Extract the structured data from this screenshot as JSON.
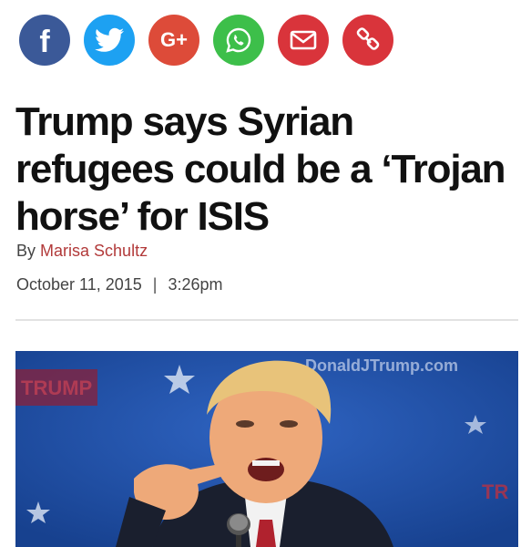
{
  "share": [
    {
      "name": "facebook",
      "icon": "facebook-icon",
      "color": "#3b5998"
    },
    {
      "name": "twitter",
      "icon": "twitter-icon",
      "color": "#1da1f2"
    },
    {
      "name": "google-plus",
      "icon": "google-plus-icon",
      "color": "#dd4b39",
      "label": "G+"
    },
    {
      "name": "whatsapp",
      "icon": "whatsapp-icon",
      "color": "#3dbf4a"
    },
    {
      "name": "email",
      "icon": "email-icon",
      "color": "#d9343b"
    },
    {
      "name": "link",
      "icon": "link-icon",
      "color": "#d9343b"
    }
  ],
  "article": {
    "headline": "Trump says Syrian refugees could be a ‘Trojan horse’ for ISIS",
    "byline_prefix": "By",
    "author": "Marisa Schultz",
    "date": "October 11, 2015",
    "separator": "|",
    "time": "3:26pm"
  },
  "photo": {
    "watermark": "DonaldJTrump.com",
    "left_banner_text": "TRUMP",
    "right_banner_text": "TR"
  }
}
